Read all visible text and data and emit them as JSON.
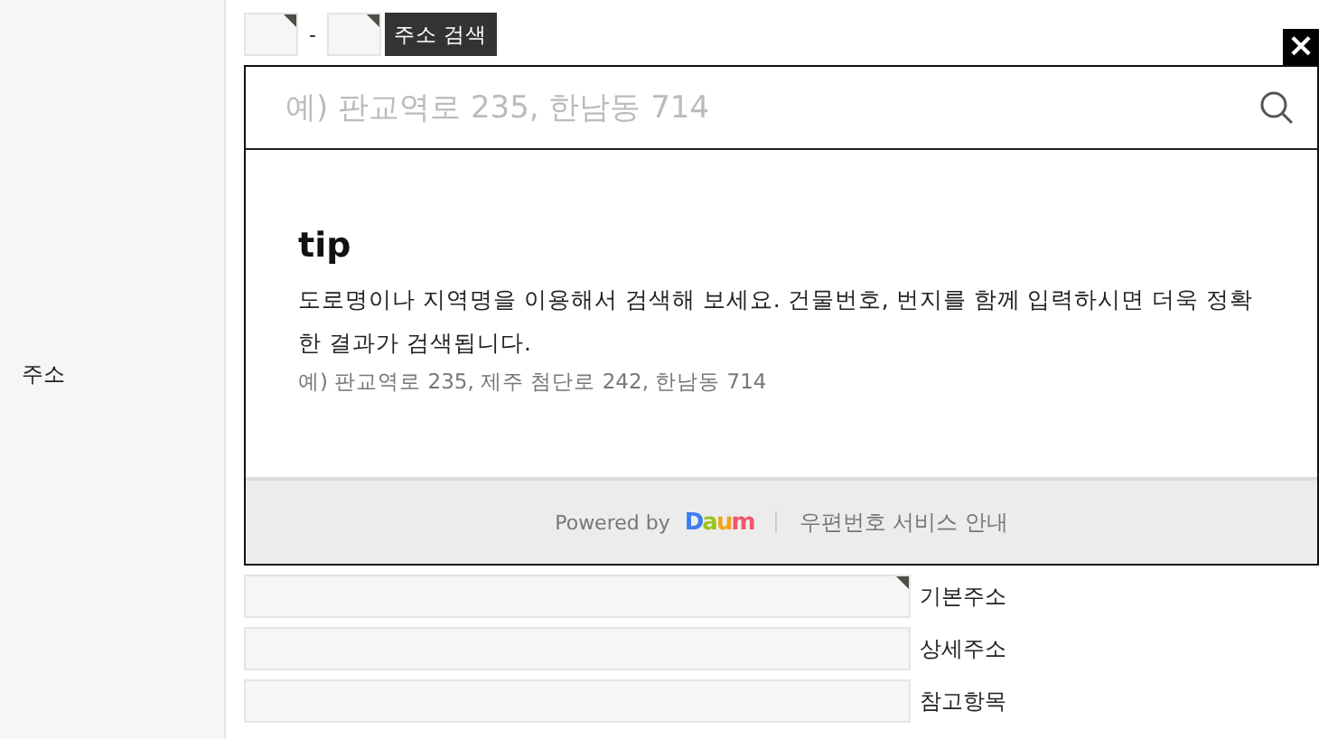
{
  "row_label": "주소",
  "zip": {
    "fields": [
      {
        "marked": true
      },
      {
        "marked": true
      }
    ],
    "separator": "-",
    "button": "주소 검색"
  },
  "popup": {
    "close": "×",
    "search": {
      "placeholder": "예) 판교역로 235, 한남동 714"
    },
    "tip": {
      "title": "tip",
      "text": "도로명이나 지역명을 이용해서 검색해 보세요. 건물번호, 번지를 함께 입력하시면 더욱 정확한 결과가 검색됩니다.",
      "example": "예) 판교역로 235, 제주 첨단로 242, 한남동 714"
    },
    "footer": {
      "powered": "Powered by",
      "logo": "Daum",
      "link": "우편번호 서비스 안내"
    }
  },
  "address_fields": [
    {
      "label": "기본주소",
      "marked": true
    },
    {
      "label": "상세주소",
      "marked": false
    },
    {
      "label": "참고항목",
      "marked": false
    }
  ]
}
